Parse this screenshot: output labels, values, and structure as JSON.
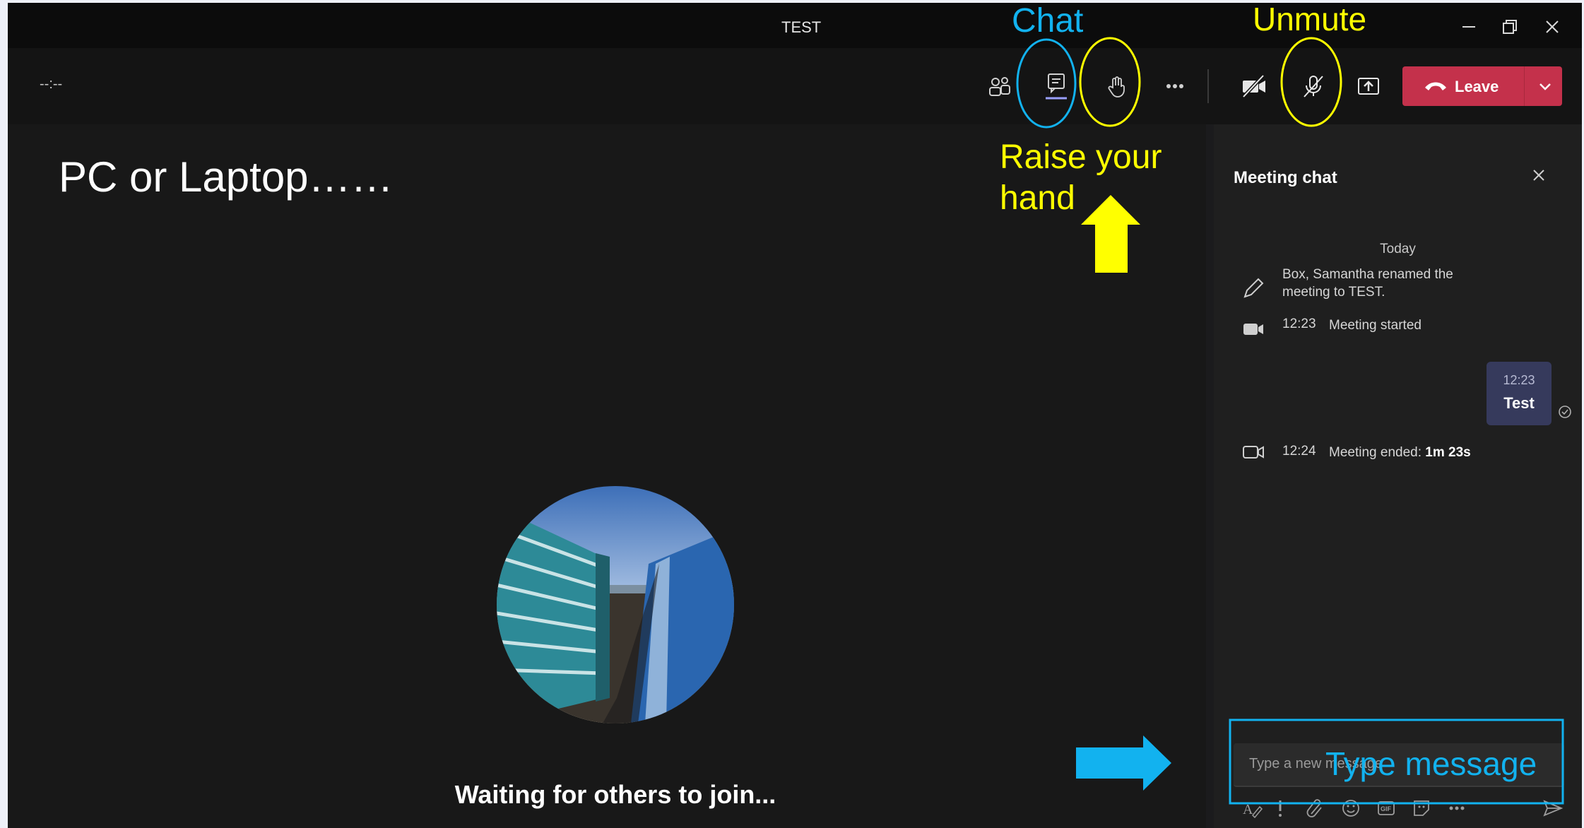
{
  "window": {
    "title": "TEST"
  },
  "toolbar": {
    "timer": "--:--",
    "leave_label": "Leave"
  },
  "stage": {
    "heading": "PC or Laptop……",
    "waiting_text": "Waiting for others to join..."
  },
  "chat": {
    "title": "Meeting chat",
    "day_divider": "Today",
    "rename_event": [
      "Box, Samantha renamed the",
      "meeting to TEST."
    ],
    "started_time": "12:23",
    "started_text": "Meeting started",
    "message": {
      "time": "12:23",
      "text": "Test"
    },
    "ended_time": "12:24",
    "ended_text": "Meeting ended: ",
    "ended_duration": "1m 23s",
    "input_placeholder": "Type a new message"
  },
  "annotations": {
    "chat": "Chat",
    "unmute": "Unmute",
    "raise_hand": [
      "Raise your",
      "hand"
    ],
    "type_message": "Type message",
    "colors": {
      "blue": "#12b2ef",
      "yellow": "#ffff00"
    }
  },
  "colors": {
    "leave_button": "#c4314b",
    "bubble": "#363a5c",
    "active_underline": "#9aa0ff"
  }
}
